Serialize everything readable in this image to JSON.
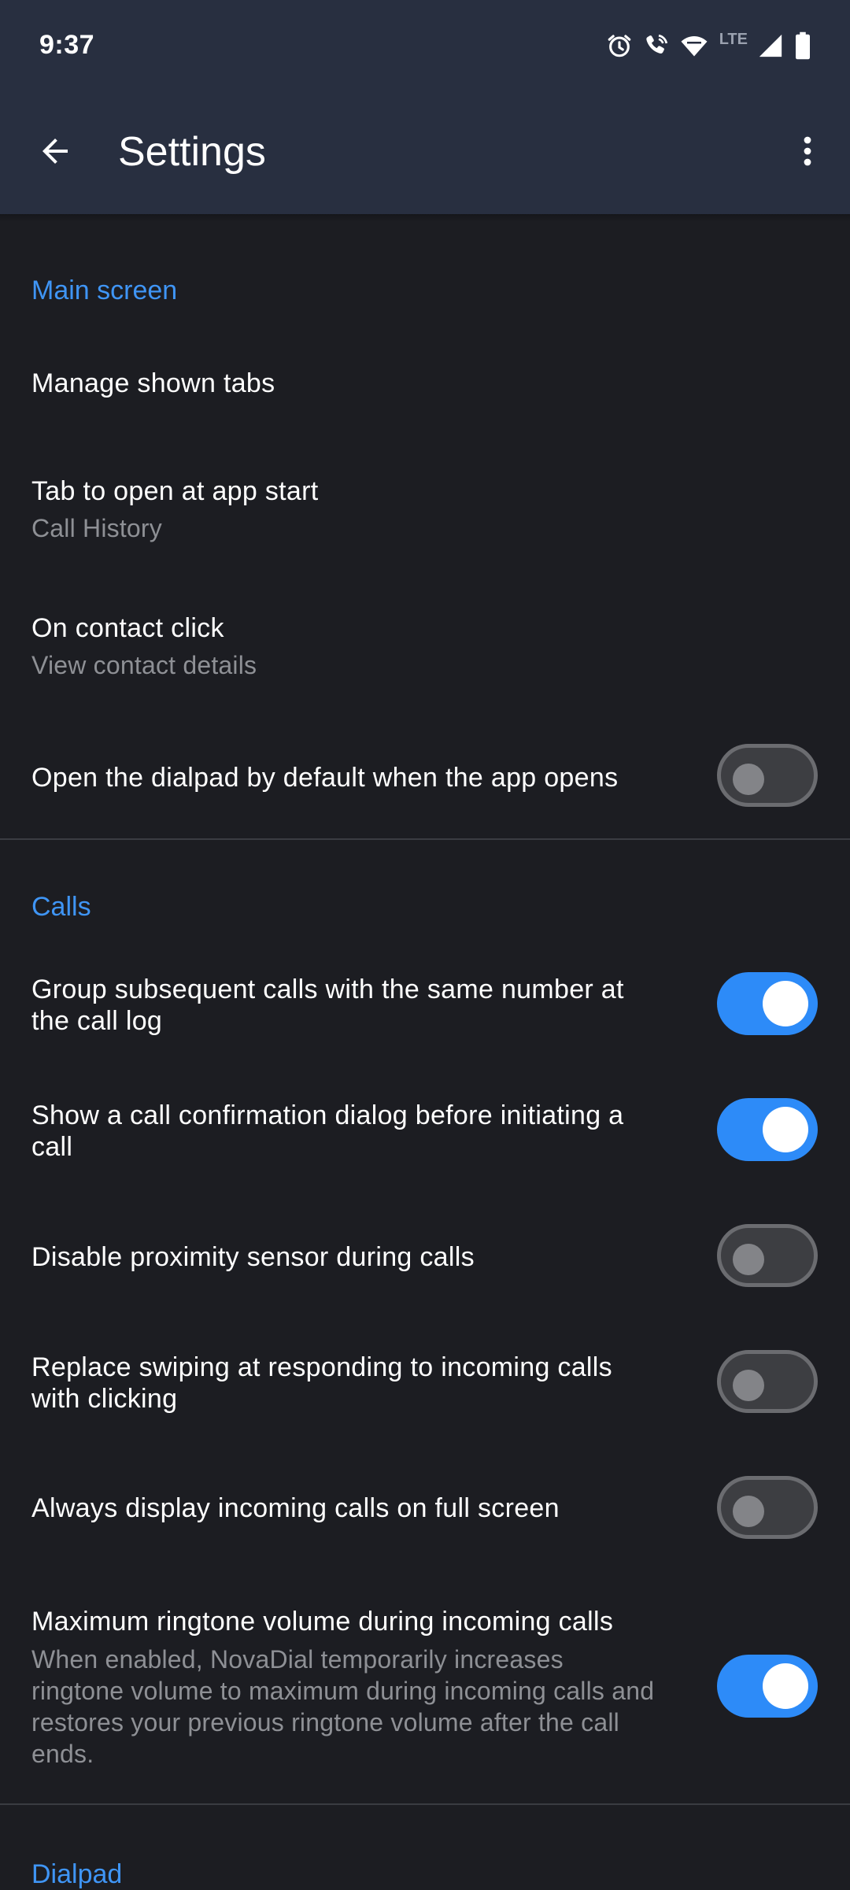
{
  "status_bar": {
    "time": "9:37",
    "network_label": "LTE",
    "icons": [
      "alarm-icon",
      "wifi-calling-icon",
      "wifi-icon",
      "cellular-signal-icon",
      "battery-icon"
    ]
  },
  "app_bar": {
    "title": "Settings",
    "back_icon": "arrow-back-icon",
    "menu_icon": "more-vert-icon",
    "background": "#282f40"
  },
  "colors": {
    "accent": "#3f95f5",
    "background": "#1c1d22",
    "toggle_on": "#2d8bf8"
  },
  "sections": {
    "main_screen": {
      "header": "Main screen",
      "manage_tabs": {
        "title": "Manage shown tabs"
      },
      "tab_at_start": {
        "title": "Tab to open at app start",
        "value": "Call History"
      },
      "contact_click": {
        "title": "On contact click",
        "value": "View contact details"
      },
      "open_dialpad": {
        "title": "Open the dialpad by default when the app opens",
        "enabled": false
      }
    },
    "calls": {
      "header": "Calls",
      "group_calls": {
        "title": "Group subsequent calls with the same number at the call log",
        "enabled": true
      },
      "confirm_dialog": {
        "title": "Show a call confirmation dialog before initiating a call",
        "enabled": true
      },
      "proximity": {
        "title": "Disable proximity sensor during calls",
        "enabled": false
      },
      "replace_swipe": {
        "title": "Replace swiping at responding to incoming calls with clicking",
        "enabled": false
      },
      "full_screen": {
        "title": "Always display incoming calls on full screen",
        "enabled": false
      },
      "max_volume": {
        "title": "Maximum ringtone volume during incoming calls",
        "description": "When enabled, NovaDial temporarily increases ringtone volume to maximum during incoming calls and restores your previous ringtone volume after the call ends.",
        "enabled": true
      }
    },
    "dialpad": {
      "header": "Dialpad"
    }
  }
}
